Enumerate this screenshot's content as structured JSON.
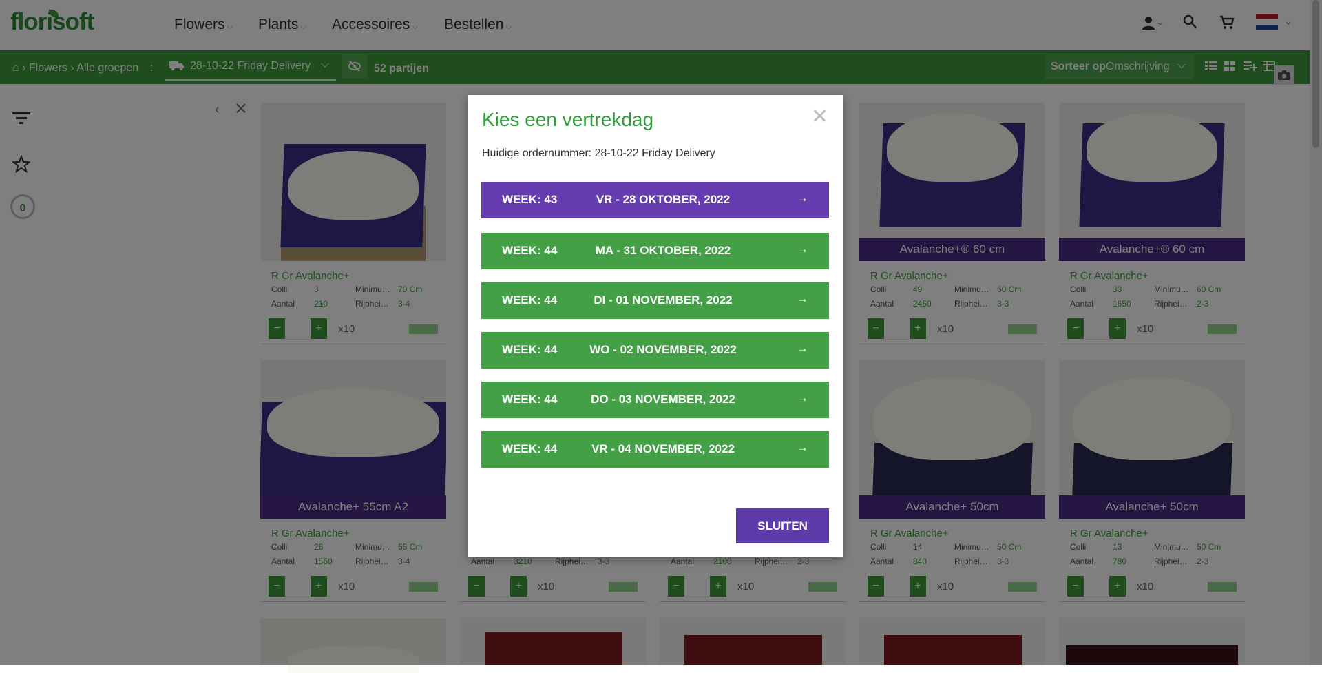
{
  "header": {
    "logo": "florisoft",
    "nav": [
      "Flowers",
      "Plants",
      "Accessoires",
      "Bestellen"
    ]
  },
  "toolbar": {
    "breadcrumb": [
      "Flowers",
      "Alle groepen"
    ],
    "delivery": "28-10-22 Friday Delivery",
    "partijen": "52 partijen",
    "sort_prefix": "Sorteer op",
    "sort_value": "Omschrijving"
  },
  "sidebar": {
    "count": "0"
  },
  "cards": [
    {
      "title": "R Gr Avalanche+",
      "colli": "3",
      "aantal": "210",
      "min": "70 Cm",
      "rijp": "3-4",
      "banner": ""
    },
    {
      "title": "R Gr Avalanche+",
      "colli": "49",
      "aantal": "2450",
      "min": "60 Cm",
      "rijp": "3-3",
      "banner": "Avalanche+® 60 cm"
    },
    {
      "title": "R Gr Avalanche+",
      "colli": "33",
      "aantal": "1650",
      "min": "60 Cm",
      "rijp": "2-3",
      "banner": "Avalanche+® 60 cm"
    },
    {
      "title": "R Gr Avalanche+",
      "colli": "26",
      "aantal": "1560",
      "min": "55 Cm",
      "rijp": "3-4",
      "banner": "Avalanche+ 55cm A2"
    },
    {
      "title": "",
      "colli": "",
      "aantal": "3210",
      "min": "",
      "rijp": "3-3",
      "banner": ""
    },
    {
      "title": "",
      "colli": "",
      "aantal": "2100",
      "min": "",
      "rijp": "2-3",
      "banner": ""
    },
    {
      "title": "R Gr Avalanche+",
      "colli": "14",
      "aantal": "840",
      "min": "50 Cm",
      "rijp": "3-3",
      "banner": "Avalanche+ 50cm"
    },
    {
      "title": "R Gr Avalanche+",
      "colli": "13",
      "aantal": "780",
      "min": "50 Cm",
      "rijp": "2-3",
      "banner": "Avalanche+ 50cm"
    }
  ],
  "labels": {
    "colli": "Colli",
    "aantal": "Aantal",
    "minimum": "Minimu…",
    "rijp": "Rijphei…",
    "x10": "x10",
    "minus": "−",
    "plus": "+"
  },
  "modal": {
    "title": "Kies een vertrekdag",
    "subtitle": "Huidige ordernummer: 28-10-22 Friday Delivery",
    "days": [
      {
        "week": "WEEK: 43",
        "date": "VR - 28 OKTOBER, 2022",
        "active": true
      },
      {
        "week": "WEEK: 44",
        "date": "MA - 31 OKTOBER, 2022",
        "active": false
      },
      {
        "week": "WEEK: 44",
        "date": "DI - 01 NOVEMBER, 2022",
        "active": false
      },
      {
        "week": "WEEK: 44",
        "date": "WO - 02 NOVEMBER, 2022",
        "active": false
      },
      {
        "week": "WEEK: 44",
        "date": "DO - 03 NOVEMBER, 2022",
        "active": false
      },
      {
        "week": "WEEK: 44",
        "date": "VR - 04 NOVEMBER, 2022",
        "active": false
      }
    ],
    "close_label": "SLUITEN",
    "arrow": "→",
    "x": "✕"
  },
  "colors": {
    "green": "#3e9a3a",
    "purple": "#663db0",
    "overlay": "rgba(0,0,0,0.5)"
  }
}
